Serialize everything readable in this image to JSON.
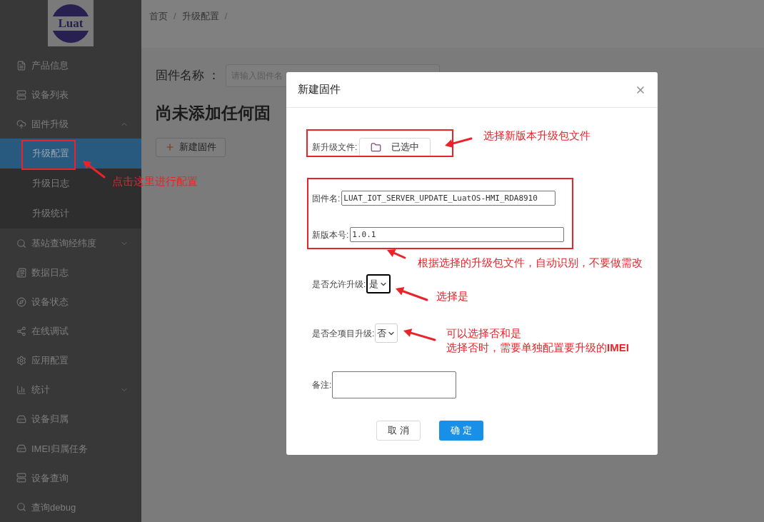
{
  "logo": {
    "text": "Luat"
  },
  "sidebar": {
    "items": [
      {
        "label": "产品信息",
        "selected": false
      },
      {
        "label": "设备列表",
        "selected": false
      },
      {
        "label": "固件升级",
        "selected": false,
        "expanded": true,
        "children": [
          {
            "label": "升级配置",
            "selected": true
          },
          {
            "label": "升级日志",
            "selected": false
          },
          {
            "label": "升级统计",
            "selected": false
          }
        ]
      },
      {
        "label": "基站查询经纬度",
        "selected": false,
        "expanded": false
      },
      {
        "label": "数据日志",
        "selected": false
      },
      {
        "label": "设备状态",
        "selected": false
      },
      {
        "label": "在线调试",
        "selected": false
      },
      {
        "label": "应用配置",
        "selected": false
      },
      {
        "label": "统计",
        "selected": false,
        "expanded": false
      },
      {
        "label": "设备归属",
        "selected": false
      },
      {
        "label": "IMEI归属任务",
        "selected": false
      },
      {
        "label": "设备查询",
        "selected": false
      },
      {
        "label": "查询debug",
        "selected": false
      }
    ]
  },
  "breadcrumb": [
    {
      "label": "首页",
      "separator": "/"
    },
    {
      "label": "升级配置",
      "separator": "/"
    }
  ],
  "filter": {
    "label": "固件名称 ：",
    "placeholder": "请输入固件名"
  },
  "heading": "尚未添加任何固",
  "new_button": "新建固件",
  "dialog": {
    "title": "新建固件",
    "fields": [
      {
        "kind": "file",
        "label": "新升级文件:",
        "value": "已选中"
      },
      {
        "kind": "text",
        "label": "固件名:",
        "value": "LUAT_IOT_SERVER_UPDATE_LuatOS-HMI_RDA8910"
      },
      {
        "kind": "text",
        "label": "新版本号:",
        "value": "1.0.1"
      },
      {
        "kind": "select",
        "label": "是否允许升级:",
        "value": "是",
        "focused": true
      },
      {
        "kind": "select",
        "label": "是否全项目升级:",
        "value": "否",
        "focused": false
      },
      {
        "kind": "textarea",
        "label": "备注:"
      }
    ],
    "buttons": [
      {
        "label": "取 消",
        "kind": "default"
      },
      {
        "label": "确 定",
        "kind": "primary"
      }
    ]
  },
  "annotations": [
    {
      "lines": [
        "点击这里进行配置"
      ]
    },
    {
      "lines": [
        "选择新版本升级包文件"
      ]
    },
    {
      "lines": [
        "根据选择的升级包文件，自动识别，不要做需改"
      ]
    },
    {
      "lines": [
        "选择是"
      ]
    },
    {
      "lines": [
        "可以选择否和是",
        "选择否时，需要单独配置要升级的**IMEI**"
      ]
    }
  ]
}
